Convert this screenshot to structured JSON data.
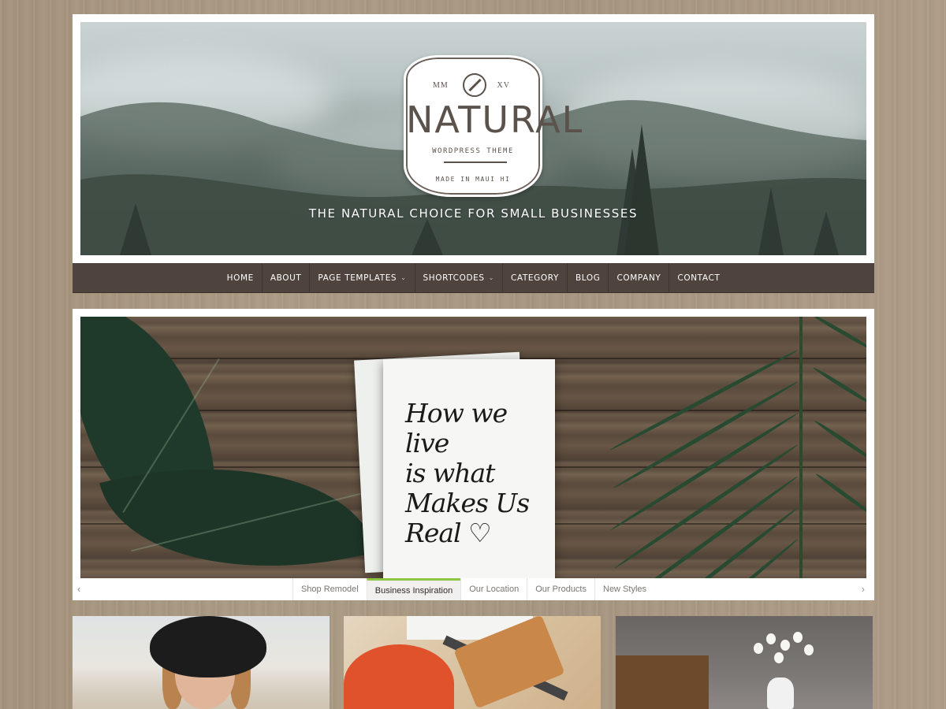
{
  "header": {
    "logo": {
      "left_text": "MM",
      "right_text": "XV",
      "title": "NATURAL",
      "subtitle": "WORDPRESS THEME",
      "made_in": "MADE IN MAUI HI"
    },
    "tagline": "THE NATURAL CHOICE FOR SMALL BUSINESSES"
  },
  "nav": {
    "items": [
      {
        "label": "HOME",
        "has_dropdown": false
      },
      {
        "label": "ABOUT",
        "has_dropdown": false
      },
      {
        "label": "PAGE TEMPLATES",
        "has_dropdown": true
      },
      {
        "label": "SHORTCODES",
        "has_dropdown": true
      },
      {
        "label": "CATEGORY",
        "has_dropdown": false
      },
      {
        "label": "BLOG",
        "has_dropdown": false
      },
      {
        "label": "COMPANY",
        "has_dropdown": false
      },
      {
        "label": "CONTACT",
        "has_dropdown": false
      }
    ],
    "caret": "⌄"
  },
  "slider": {
    "card_text": [
      "How we live",
      "is what",
      "Makes Us",
      "Real ♡"
    ],
    "tabs": [
      {
        "label": "Shop Remodel",
        "active": false
      },
      {
        "label": "Business Inspiration",
        "active": true
      },
      {
        "label": "Our Location",
        "active": false
      },
      {
        "label": "Our Products",
        "active": false
      },
      {
        "label": "New Styles",
        "active": false
      }
    ],
    "prev_arrow": "‹",
    "next_arrow": "›",
    "accent_color": "#8dc63f"
  },
  "colors": {
    "nav_bg": "#4e433d",
    "background": "#a8967f"
  }
}
